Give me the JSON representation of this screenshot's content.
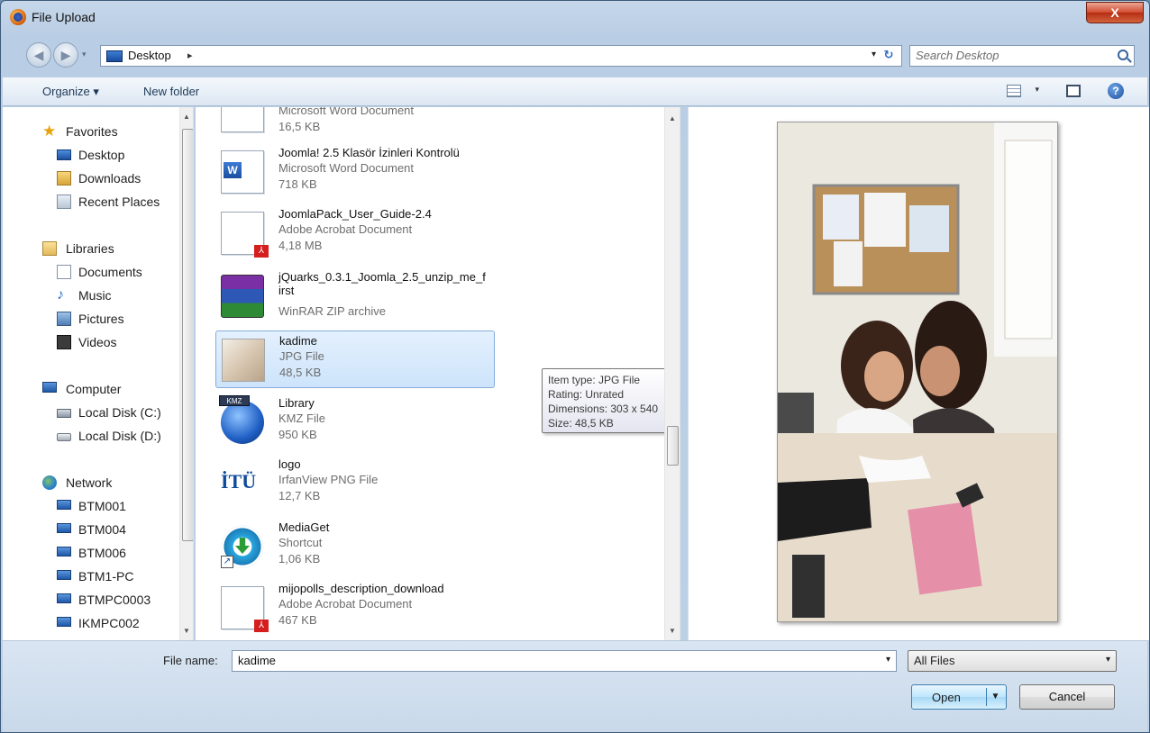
{
  "window": {
    "title": "File Upload",
    "close_label": "X"
  },
  "address": {
    "location": "Desktop",
    "separator": "▸",
    "search_placeholder": "Search Desktop"
  },
  "toolbar": {
    "organize": "Organize ▾",
    "new_folder": "New folder"
  },
  "nav": {
    "favorites": {
      "label": "Favorites",
      "items": [
        "Desktop",
        "Downloads",
        "Recent Places"
      ]
    },
    "libraries": {
      "label": "Libraries",
      "items": [
        "Documents",
        "Music",
        "Pictures",
        "Videos"
      ]
    },
    "computer": {
      "label": "Computer",
      "items": [
        "Local Disk (C:)",
        "Local Disk (D:)"
      ]
    },
    "network": {
      "label": "Network",
      "items": [
        "BTM001",
        "BTM004",
        "BTM006",
        "BTM1-PC",
        "BTMPC0003",
        "IKMPC002"
      ]
    }
  },
  "files": [
    {
      "name": "",
      "type": "Microsoft Word Document",
      "size": "16,5 KB"
    },
    {
      "name": "Joomla! 2.5 Klasör İzinleri Kontrolü",
      "type": "Microsoft Word Document",
      "size": "718 KB"
    },
    {
      "name": "JoomlaPack_User_Guide-2.4",
      "type": "Adobe Acrobat Document",
      "size": "4,18 MB"
    },
    {
      "name": "jQuarks_0.3.1_Joomla_2.5_unzip_me_first",
      "type": "WinRAR ZIP archive",
      "size": ""
    },
    {
      "name": "kadime",
      "type": "JPG File",
      "size": "48,5 KB"
    },
    {
      "name": "Library",
      "type": "KMZ File",
      "size": "950 KB"
    },
    {
      "name": "logo",
      "type": "IrfanView PNG File",
      "size": "12,7 KB"
    },
    {
      "name": "MediaGet",
      "type": "Shortcut",
      "size": "1,06 KB"
    },
    {
      "name": "mijopolls_description_download",
      "type": "Adobe Acrobat Document",
      "size": "467 KB"
    }
  ],
  "thumbnails": {
    "word": "W",
    "pdf": "⅄",
    "kmz": "KMZ",
    "itu": "İTÜ"
  },
  "tooltip": {
    "item_type": "Item type: JPG File",
    "rating": "Rating: Unrated",
    "dimensions": "Dimensions: 303 x 540",
    "size": "Size: 48,5 KB"
  },
  "bottom": {
    "file_name_label": "File name:",
    "file_name_value": "kadime",
    "filter": "All Files",
    "open": "Open",
    "cancel": "Cancel"
  },
  "icons": {
    "help": "?",
    "dropdown": "▾",
    "back": "◀",
    "forward": "▶",
    "refresh": "↻",
    "scroll_up": "▲",
    "scroll_down": "▼"
  }
}
